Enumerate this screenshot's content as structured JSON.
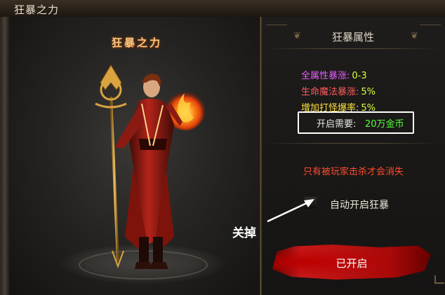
{
  "window": {
    "title": "狂暴之力"
  },
  "hero": {
    "banner": "狂暴之力"
  },
  "attributes_panel": {
    "title": "狂暴属性",
    "stats": [
      {
        "label": "全属性暴涨:",
        "value": "0-3",
        "label_color": "#e65cff"
      },
      {
        "label": "生命魔法暴涨:",
        "value": "5%",
        "label_color": "#ff5a5a"
      },
      {
        "label": "增加打怪爆率:",
        "value": "5%",
        "label_color": "#ffe23a"
      }
    ],
    "cost": {
      "label": "开启需要:",
      "value": "20万金币"
    },
    "warning": "只有被玩家击杀才会消失",
    "auto_toggle": {
      "label": "自动开启狂暴",
      "checked": false
    },
    "status_button": {
      "label": "已开启"
    }
  },
  "annotation": {
    "label": "关掉"
  }
}
